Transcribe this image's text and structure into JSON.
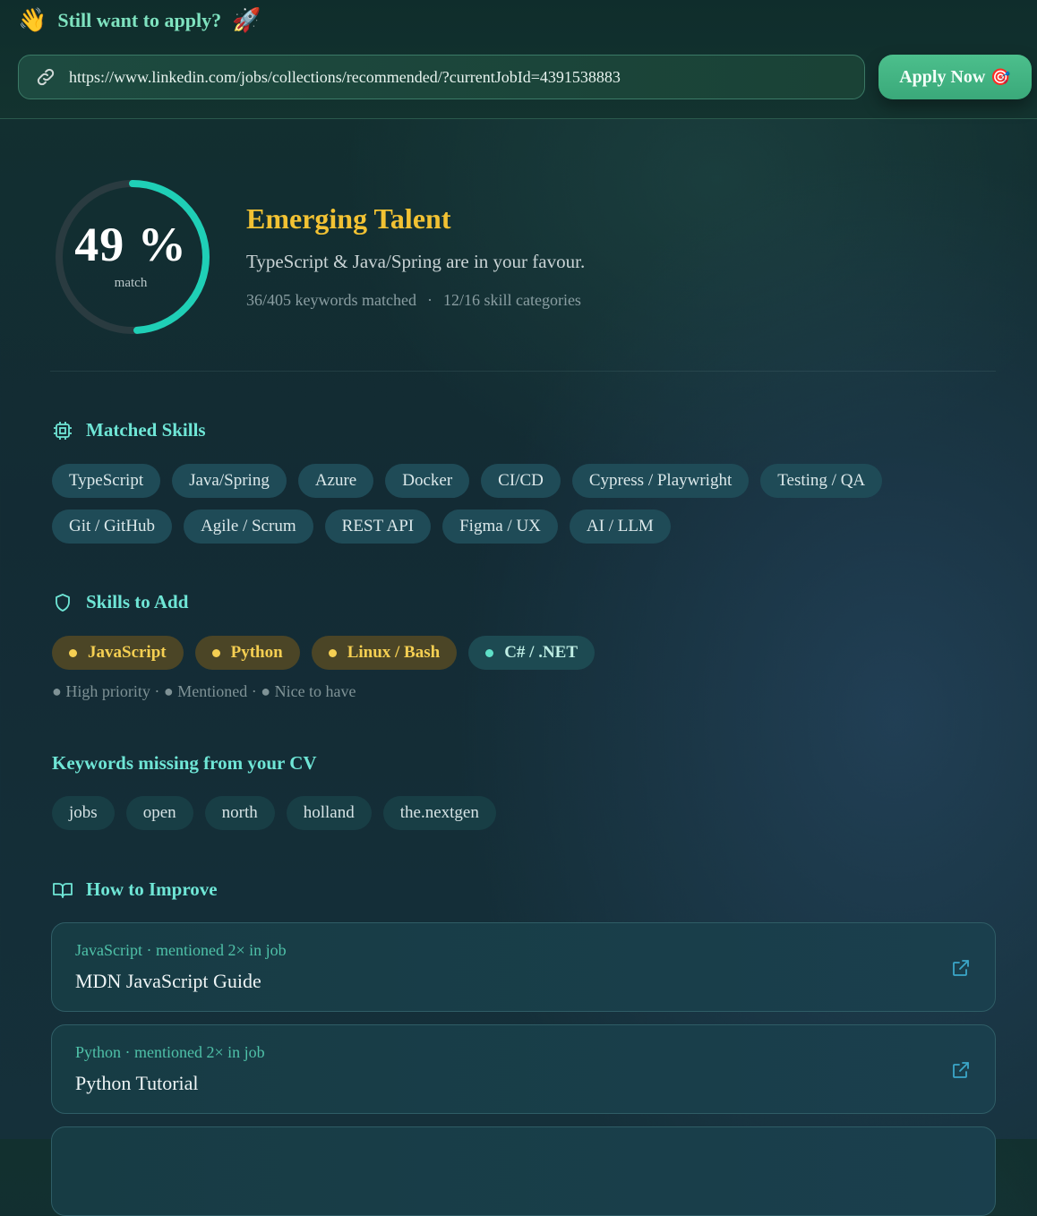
{
  "header": {
    "wave_emoji": "👋",
    "title": "Still want to apply?",
    "rocket_emoji": "🚀",
    "url_value": "https://www.linkedin.com/jobs/collections/recommended/?currentJobId=4391538883",
    "apply_label": "Apply Now",
    "apply_emoji": "🎯",
    "link_icon": "link-icon"
  },
  "match": {
    "percent": 49,
    "percent_text": "49 %",
    "label": "match",
    "tier": "Emerging Talent",
    "summary": "TypeScript & Java/Spring are in your favour.",
    "keywords_matched": "36/405 keywords matched",
    "separator": "·",
    "categories_matched": "12/16 skill categories"
  },
  "matched_skills": {
    "title": "Matched Skills",
    "icon": "chip-icon",
    "items": [
      "TypeScript",
      "Java/Spring",
      "Azure",
      "Docker",
      "CI/CD",
      "Cypress / Playwright",
      "Testing / QA",
      "Git / GitHub",
      "Agile / Scrum",
      "REST API",
      "Figma / UX",
      "AI / LLM"
    ]
  },
  "skills_to_add": {
    "title": "Skills to Add",
    "icon": "shield-icon",
    "items": [
      {
        "label": "JavaScript",
        "priority": "high"
      },
      {
        "label": "Python",
        "priority": "high"
      },
      {
        "label": "Linux / Bash",
        "priority": "high"
      },
      {
        "label": "C# / .NET",
        "priority": "nice"
      }
    ],
    "legend": "● High priority · ● Mentioned · ● Nice to have"
  },
  "missing_keywords": {
    "title": "Keywords missing from your CV",
    "items": [
      "jobs",
      "open",
      "north",
      "holland",
      "the.nextgen"
    ]
  },
  "improve": {
    "title": "How to Improve",
    "icon": "book-icon",
    "resources": [
      {
        "meta": "JavaScript · mentioned 2× in job",
        "name": "MDN JavaScript Guide"
      },
      {
        "meta": "Python · mentioned 2× in job",
        "name": "Python Tutorial"
      }
    ]
  },
  "colors": {
    "accent_teal": "#1fcfb6",
    "tier_gold": "#f2c233",
    "apply_green": "#43b583",
    "high_priority": "#f5cf52",
    "nice_to_have": "#5fe0c8"
  }
}
